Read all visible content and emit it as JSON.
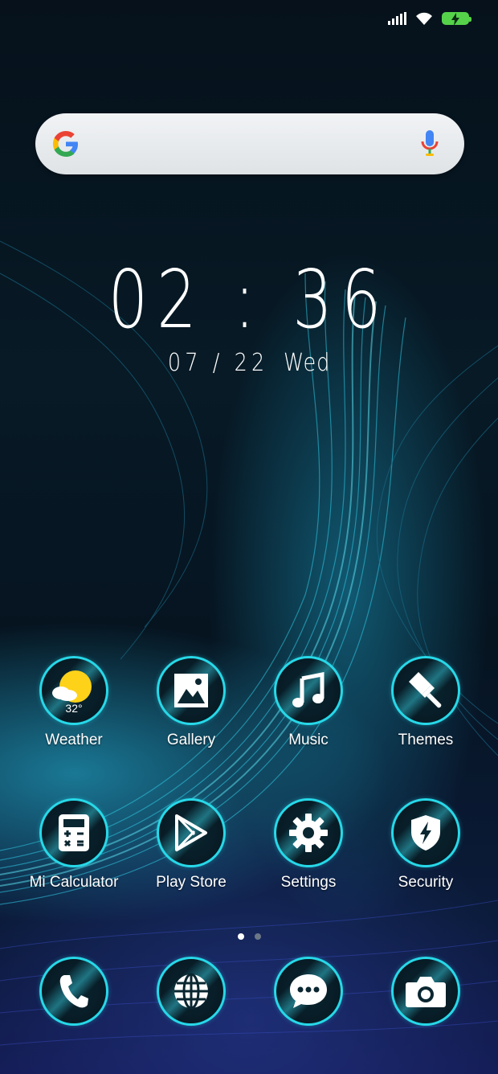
{
  "status_bar": {
    "signal_icon": "signal-bars-icon",
    "wifi_icon": "wifi-icon",
    "battery_icon": "battery-charging-icon"
  },
  "search": {
    "logo_icon": "google-g-icon",
    "mic_icon": "microphone-icon"
  },
  "clock": {
    "time": "02 : 36",
    "date": "07 / 22",
    "day": "Wed"
  },
  "apps": [
    {
      "label": "Weather",
      "icon": "weather-sun-icon",
      "temp": "32°"
    },
    {
      "label": "Gallery",
      "icon": "gallery-image-icon"
    },
    {
      "label": "Music",
      "icon": "music-note-icon"
    },
    {
      "label": "Themes",
      "icon": "paintbrush-icon"
    },
    {
      "label": "Mi Calculator",
      "icon": "calculator-icon"
    },
    {
      "label": "Play Store",
      "icon": "play-store-icon"
    },
    {
      "label": "Settings",
      "icon": "gear-icon"
    },
    {
      "label": "Security",
      "icon": "shield-bolt-icon"
    }
  ],
  "dock": [
    {
      "icon": "phone-icon"
    },
    {
      "icon": "browser-globe-icon"
    },
    {
      "icon": "messaging-bubble-icon"
    },
    {
      "icon": "camera-icon"
    }
  ],
  "page_indicator": {
    "pages": 2,
    "current": 1
  },
  "colors": {
    "accent": "#27d8e8",
    "battery": "#55d24a",
    "weather_sun": "#ffd21a",
    "dot_active": "#ffffff",
    "dot_inactive": "#6b7785"
  }
}
